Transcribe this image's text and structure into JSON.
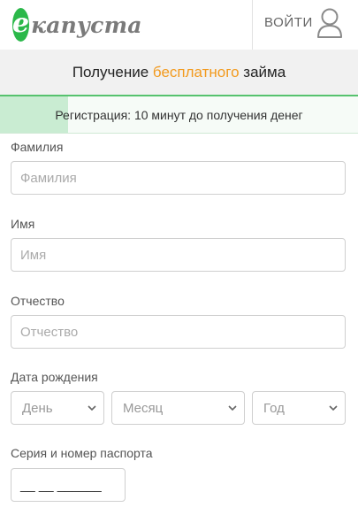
{
  "header": {
    "logo_letter": "е",
    "logo_text": "капуста",
    "login_label": "ВОЙТИ"
  },
  "title": {
    "prefix": "Получение ",
    "accent": "бесплатного",
    "suffix": " займа"
  },
  "progress": {
    "text": "Регистрация: 10 минут до получения денег",
    "fraction": 0.19
  },
  "form": {
    "surname": {
      "label": "Фамилия",
      "placeholder": "Фамилия",
      "value": ""
    },
    "name": {
      "label": "Имя",
      "placeholder": "Имя",
      "value": ""
    },
    "patronymic": {
      "label": "Отчество",
      "placeholder": "Отчество",
      "value": ""
    },
    "birthdate": {
      "label": "Дата рождения",
      "day": "День",
      "month": "Месяц",
      "year": "Год"
    },
    "passport": {
      "label": "Серия и номер паспорта",
      "mask": "__ __ ______"
    }
  },
  "colors": {
    "brand_green": "#2bb84a",
    "accent_orange": "#f29a1e",
    "progress_fill": "#c9ecd2"
  }
}
